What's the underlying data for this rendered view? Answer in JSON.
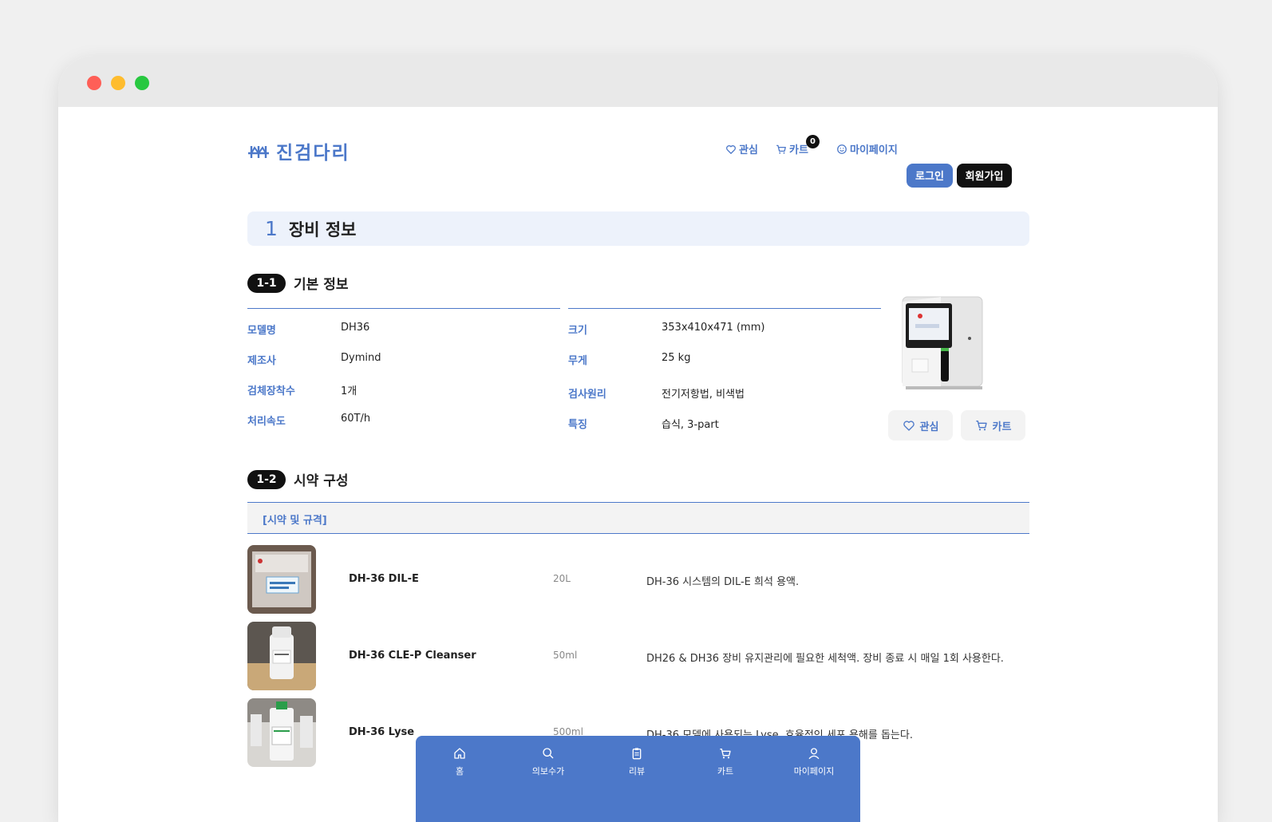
{
  "brand": {
    "name": "진검다리",
    "accent": "#4c78c9"
  },
  "header": {
    "wishlist": "관심",
    "cart": "카트",
    "cart_count": "0",
    "mypage": "마이페이지",
    "login": "로그인",
    "signup": "회원가입"
  },
  "section": {
    "number": "1",
    "title": "장비 정보"
  },
  "basic_info": {
    "badge": "1-1",
    "title": "기본 정보",
    "left": [
      {
        "label": "모델명",
        "value": "DH36"
      },
      {
        "label": "제조사",
        "value": "Dymind"
      },
      {
        "label": "검체장착수",
        "value": "1개"
      },
      {
        "label": "처리속도",
        "value": "60T/h"
      }
    ],
    "right": [
      {
        "label": "크기",
        "value": "353x410x471 (mm)"
      },
      {
        "label": "무게",
        "value": "25 kg"
      },
      {
        "label": "검사원리",
        "value": "전기저항법, 비색법"
      },
      {
        "label": "특징",
        "value": "습식, 3-part"
      }
    ],
    "wishlist_button": "관심",
    "cart_button": "카트"
  },
  "reagents": {
    "badge": "1-2",
    "title": "시약 구성",
    "table_header": "[시약 및 규격]",
    "items": [
      {
        "name": "DH-36 DIL-E",
        "size": "20L",
        "desc": "DH-36 시스템의 DIL-E 희석 용액."
      },
      {
        "name": "DH-36 CLE-P Cleanser",
        "size": "50ml",
        "desc": "DH26 & DH36 장비 유지관리에 필요한 세척액. 장비 종료 시 매일 1회 사용한다."
      },
      {
        "name": "DH-36 Lyse",
        "size": "500ml",
        "desc": "DH-36 모델에 사용되는 Lyse. 효율적인 세포 용해를 돕는다."
      }
    ]
  },
  "bottom_nav": [
    {
      "label": "홈",
      "icon": "home-icon"
    },
    {
      "label": "의보수가",
      "icon": "search-icon"
    },
    {
      "label": "리뷰",
      "icon": "clipboard-icon"
    },
    {
      "label": "카트",
      "icon": "cart-icon"
    },
    {
      "label": "마이페이지",
      "icon": "user-icon"
    }
  ]
}
